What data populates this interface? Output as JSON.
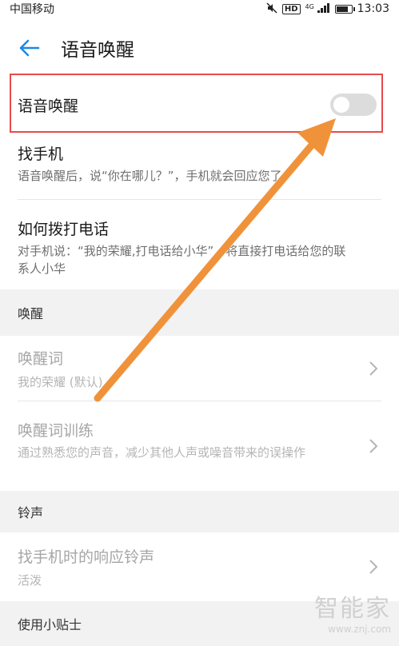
{
  "statusbar": {
    "carrier": "中国移动",
    "time": "13:03",
    "hd": "HD",
    "network": "4G",
    "battery_level": 0.85
  },
  "appbar": {
    "title": "语音唤醒"
  },
  "voice_wake": {
    "label": "语音唤醒",
    "enabled": false
  },
  "find_phone": {
    "title": "找手机",
    "subtitle": "语音唤醒后，说“你在哪儿？”，手机就会回应您了"
  },
  "call": {
    "title": "如何拨打电话",
    "subtitle": "对手机说：“我的荣耀,打电话给小华”，将直接打电话给您的联系人小华"
  },
  "section_wake": "唤醒",
  "wake_word": {
    "title": "唤醒词",
    "subtitle": "我的荣耀 (默认)"
  },
  "wake_training": {
    "title": "唤醒词训练",
    "subtitle": "通过熟悉您的声音，减少其他人声或噪音带来的误操作"
  },
  "section_ringtone": "铃声",
  "find_ringtone": {
    "title": "找手机时的响应铃声",
    "subtitle": "活泼"
  },
  "section_tips": "使用小贴士",
  "watermark": {
    "name": "智能家",
    "url": "www.znj.com"
  },
  "colors": {
    "accent": "#1e88e5",
    "highlight": "#e84a4a",
    "arrow": "#f0923a"
  }
}
